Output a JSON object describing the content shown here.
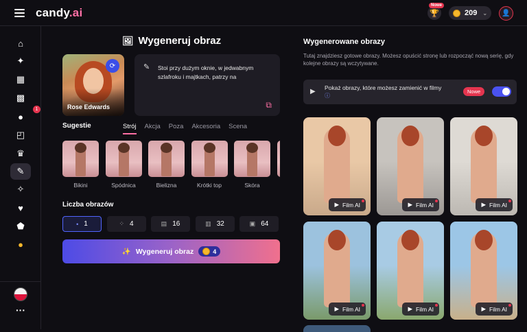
{
  "header": {
    "logo_main": "candy",
    "logo_suffix": ".ai",
    "new_badge": "Nowe",
    "coins": "209"
  },
  "sidebar": {
    "items": [
      {
        "name": "home-icon",
        "glyph": "⌂"
      },
      {
        "name": "compass-icon",
        "glyph": "✦"
      },
      {
        "name": "film-icon",
        "glyph": "▦"
      },
      {
        "name": "grid-icon",
        "glyph": "▩"
      },
      {
        "name": "chat-icon",
        "glyph": "●",
        "badge": "1"
      },
      {
        "name": "gallery-icon",
        "glyph": "◰"
      },
      {
        "name": "trophy-icon",
        "glyph": "♛"
      },
      {
        "name": "generate-image-icon",
        "glyph": "✎",
        "active": true
      },
      {
        "name": "magic-wand-icon",
        "glyph": "✧"
      },
      {
        "name": "heart-icon",
        "glyph": "♥"
      },
      {
        "name": "lock-icon",
        "glyph": "⬟"
      },
      {
        "name": "coin-icon",
        "glyph": "●"
      }
    ]
  },
  "generator": {
    "title": "Wygeneruj obraz",
    "character_name": "Rose Edwards",
    "prompt_text": "Stoi przy dużym oknie, w jedwabnym szlafroku i majtkach, patrzy na",
    "suggestions_label": "Sugestie",
    "tabs": [
      "Strój",
      "Akcja",
      "Poza",
      "Akcesoria",
      "Scena"
    ],
    "active_tab": "Strój",
    "suggestions": [
      {
        "label": "Bikini"
      },
      {
        "label": "Spódnica"
      },
      {
        "label": "Bielizna"
      },
      {
        "label": "Krótki top"
      },
      {
        "label": "Skóra"
      },
      {
        "label": "S"
      }
    ],
    "count_label": "Liczba obrazów",
    "counts": [
      "1",
      "4",
      "16",
      "32",
      "64"
    ],
    "selected_count": "1",
    "generate_button": "Wygeneruj obraz",
    "generate_cost": "4"
  },
  "results": {
    "title": "Wygenerowane obrazy",
    "description": "Tutaj znajdziesz gotowe obrazy. Możesz opuścić stronę lub rozpocząć nową serię, gdy kolejne obrazy są wczytywane.",
    "video_toggle_text": "Pokaż obrazy, które możesz zamienić w filmy",
    "video_toggle_badge": "Nowe",
    "video_toggle_on": true,
    "film_label": "Film AI",
    "cards": [
      {
        "bg": "#c9a98a",
        "sky": "#e9c8a6"
      },
      {
        "bg": "#9c9894",
        "sky": "#c7c3be"
      },
      {
        "bg": "#bcb8b2",
        "sky": "#dedad4"
      },
      {
        "bg": "#7a9a6a",
        "sky": "#9cc2de"
      },
      {
        "bg": "#8aa86e",
        "sky": "#a8cbe4"
      },
      {
        "bg": "#c8b08a",
        "sky": "#9cc6e6"
      }
    ]
  }
}
